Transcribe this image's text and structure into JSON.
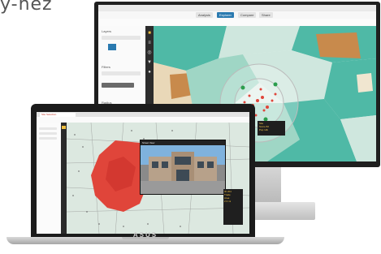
{
  "header_text": "y-nez",
  "monitor": {
    "browser_title": "",
    "tabs": [
      {
        "label": "Analysis",
        "active": false
      },
      {
        "label": "Explorer",
        "active": true
      },
      {
        "label": "Compare",
        "active": false
      },
      {
        "label": "Share",
        "active": false
      }
    ],
    "side_labels": [
      "Layers",
      "Filters",
      "Radius"
    ],
    "map_tools": [
      "layers-icon",
      "search-icon",
      "zoom-icon",
      "filter-icon",
      "pin-icon"
    ],
    "callout_lines": [
      "Site",
      "Score 82",
      "Pop 12k"
    ]
  },
  "laptop": {
    "tab_label": "Site Selection",
    "photo_title": "Street View",
    "info_lines": [
      "ID 204",
      "Trade",
      "Area",
      "2.3 mi"
    ],
    "legend_lines": [
      "Pop.",
      "High",
      "Med",
      "Low"
    ],
    "brand": "ASUS"
  },
  "colors": {
    "map_teal": "#4fb9a6",
    "map_light": "#cfe7de",
    "map_brown": "#c88a4c",
    "hotspot_red": "#e0453a",
    "chrome_dark": "#1b1b1b"
  }
}
